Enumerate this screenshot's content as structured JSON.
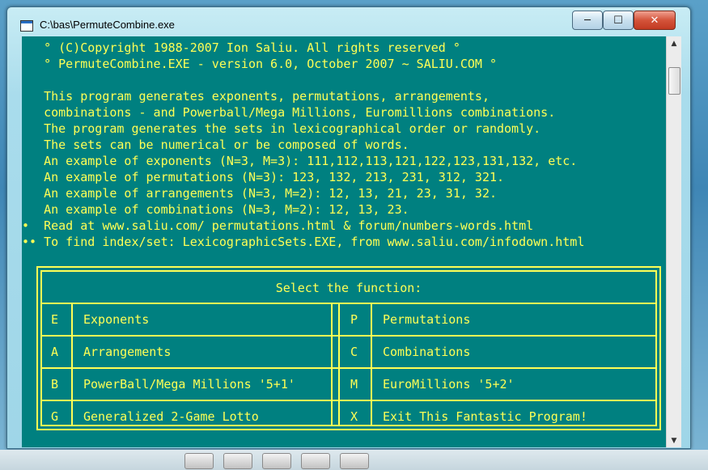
{
  "window": {
    "title": "C:\\bas\\PermuteCombine.exe",
    "buttons": {
      "minimize": "─",
      "maximize": "☐",
      "close": "✕"
    }
  },
  "console": {
    "lines": [
      "   ° (C)Copyright 1988-2007 Ion Saliu. All rights reserved °",
      "   ° PermuteCombine.EXE - version 6.0, October 2007 ~ SALIU.COM °",
      "",
      "   This program generates exponents, permutations, arrangements,",
      "   combinations - and Powerball/Mega Millions, Euromillions combinations.",
      "   The program generates the sets in lexicographical order or randomly.",
      "   The sets can be numerical or be composed of words.",
      "   An example of exponents (N=3, M=3): 111,112,113,121,122,123,131,132, etc.",
      "   An example of permutations (N=3): 123, 132, 213, 231, 312, 321.",
      "   An example of arrangements (N=3, M=2): 12, 13, 21, 23, 31, 32.",
      "   An example of combinations (N=3, M=2): 12, 13, 23.",
      "•  Read at www.saliu.com/ permutations.html & forum/numbers-words.html",
      "•• To find index/set: LexicographicSets.EXE, from www.saliu.com/infodown.html"
    ],
    "menu": {
      "title": "Select the function:",
      "options": [
        {
          "key": "E",
          "label": "Exponents"
        },
        {
          "key": "P",
          "label": "Permutations"
        },
        {
          "key": "A",
          "label": "Arrangements"
        },
        {
          "key": "C",
          "label": "Combinations"
        },
        {
          "key": "B",
          "label": "PowerBall/Mega Millions '5+1'"
        },
        {
          "key": "M",
          "label": "EuroMillions '5+2'"
        },
        {
          "key": "G",
          "label": "Generalized 2-Game Lotto"
        },
        {
          "key": "X",
          "label": "Exit This Fantastic Program!"
        }
      ]
    }
  },
  "scrollbar": {
    "up": "▲",
    "down": "▼"
  },
  "colors": {
    "console_bg": "#008080",
    "console_text": "#ffff55"
  }
}
